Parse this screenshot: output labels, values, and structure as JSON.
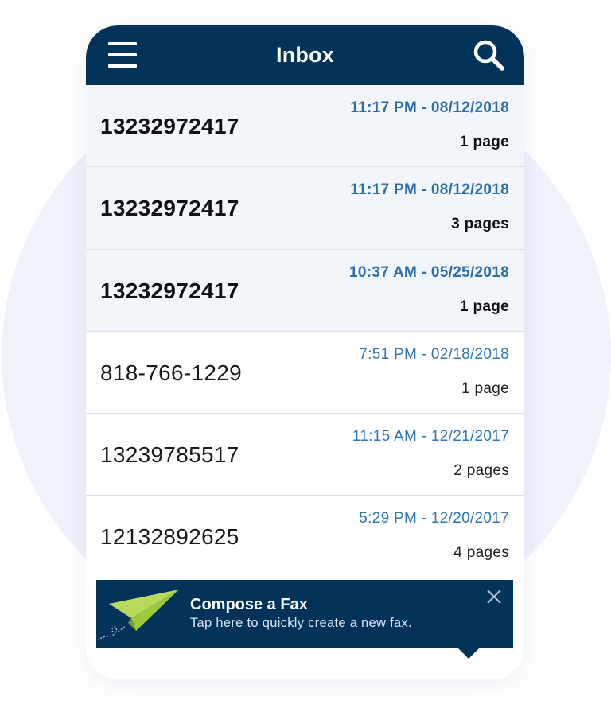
{
  "header": {
    "title": "Inbox",
    "menu_icon": "hamburger-menu-icon",
    "search_icon": "search-icon",
    "background_color": "#01325a"
  },
  "faxes": [
    {
      "number": "13232972417",
      "datetime": "11:17 PM - 08/12/2018",
      "pages": "1 page",
      "unread": true
    },
    {
      "number": "13232972417",
      "datetime": "11:17 PM - 08/12/2018",
      "pages": "3 pages",
      "unread": true
    },
    {
      "number": "13232972417",
      "datetime": "10:37 AM - 05/25/2018",
      "pages": "1 page",
      "unread": true
    },
    {
      "number": "818-766-1229",
      "datetime": "7:51 PM - 02/18/2018",
      "pages": "1 page",
      "unread": false
    },
    {
      "number": "13239785517",
      "datetime": "11:15 AM - 12/21/2017",
      "pages": "2 pages",
      "unread": false
    },
    {
      "number": "12132892625",
      "datetime": "5:29 PM - 12/20/2017",
      "pages": "4 pages",
      "unread": false
    }
  ],
  "compose_tip": {
    "title": "Compose a Fax",
    "subtitle": "Tap here to quickly create a new fax.",
    "icon": "paper-plane-icon",
    "close_icon": "close-icon"
  },
  "colors": {
    "accent_date": "#2f77b3",
    "unread_row_bg": "#f2f6fb",
    "plane_green": "#9bc93c"
  }
}
